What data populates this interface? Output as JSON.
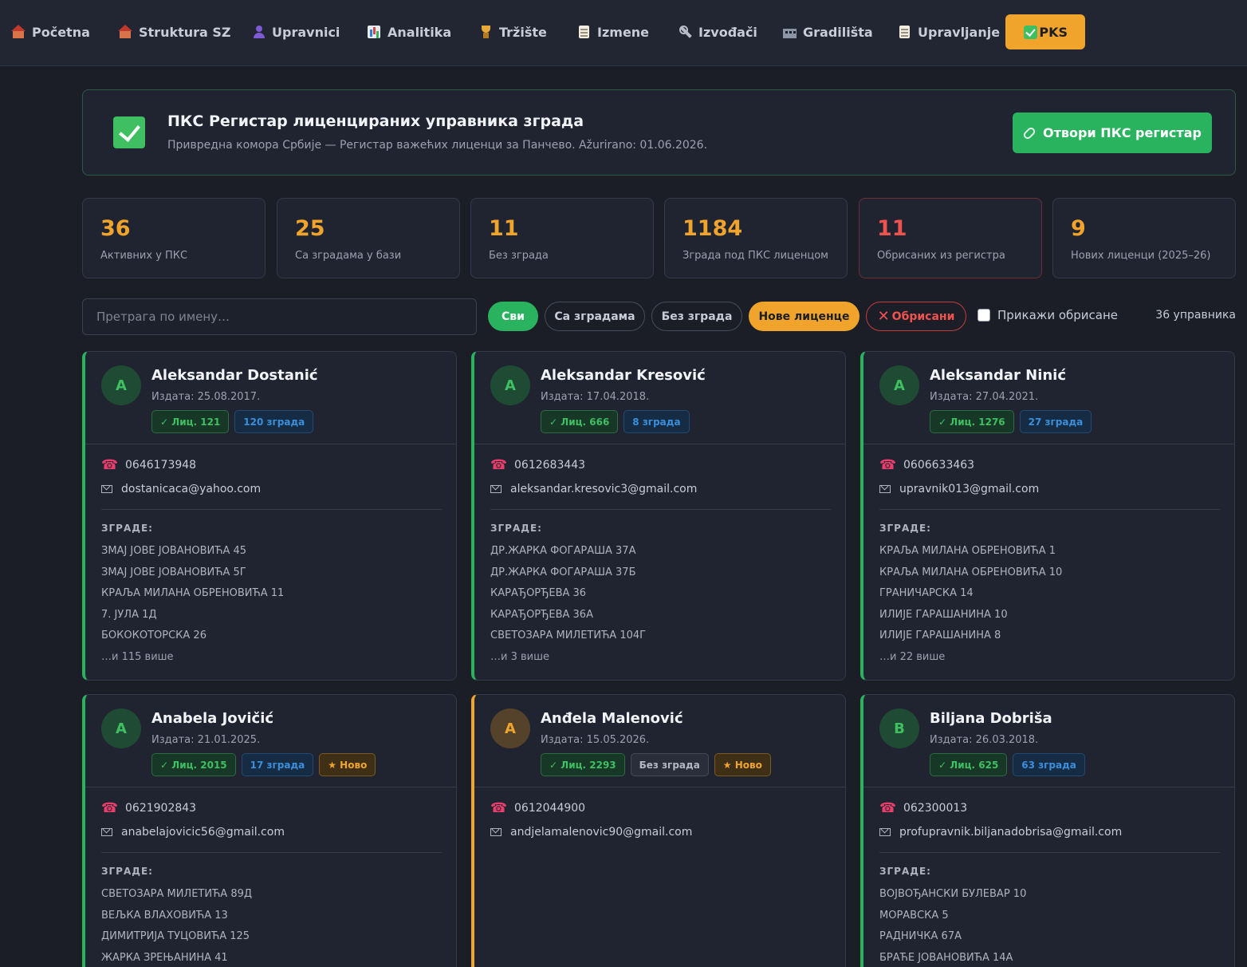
{
  "nav": [
    {
      "label": "Početna",
      "icon": "house-icon"
    },
    {
      "label": "Struktura SZ",
      "icon": "house-icon"
    },
    {
      "label": "Upravnici",
      "icon": "user-icon"
    },
    {
      "label": "Analitika",
      "icon": "chart-icon"
    },
    {
      "label": "Tržište",
      "icon": "trophy-icon"
    },
    {
      "label": "Izmene",
      "icon": "document-icon"
    },
    {
      "label": "Izvođači",
      "icon": "wrench-icon"
    },
    {
      "label": "Gradilišta",
      "icon": "construction-site-icon"
    },
    {
      "label": "Upravljanje",
      "icon": "document-icon"
    },
    {
      "label": "PKS",
      "icon": "checkmark-icon"
    }
  ],
  "header": {
    "title": "ПКС Регистар лиценцираних управника зграда",
    "subtitle": "Привредна комора Србије — Регистар важећих лиценци за Панчево. Ažurirano: 01.06.2026.",
    "open_button": "Отвори ПКС регистар"
  },
  "stats": [
    {
      "value": "36",
      "label": "Активних у ПКС"
    },
    {
      "value": "25",
      "label": "Са зградама у бази"
    },
    {
      "value": "11",
      "label": "Без зграда"
    },
    {
      "value": "1184",
      "label": "Зграда под ПКС лиценцом"
    },
    {
      "value": "11",
      "label": "Обрисаних из регистра"
    },
    {
      "value": "9",
      "label": "Нових лиценци (2025–26)"
    }
  ],
  "filters": {
    "search_placeholder": "Претрага по имену…",
    "chips": [
      "Сви",
      "Са зградама",
      "Без зграда",
      "Нове лиценце",
      "Обрисани"
    ],
    "show_deleted": "Прикажи обрисане",
    "count": "36 управника"
  },
  "buildings_title": "ЗГРАДЕ:",
  "managers": [
    {
      "initial": "A",
      "name": "Aleksandar Dostanić",
      "issued": "Издата: 25.08.2017.",
      "license": "✓ Лиц. 121",
      "buildings_badge": "120 зграда",
      "new_badge": "",
      "phone": "0646173948",
      "email": "dostanicaca@yahoo.com",
      "buildings": [
        "ЗМАЈ ЈОВЕ ЈОВАНОВИЋА 45",
        "ЗМАЈ ЈОВЕ ЈОВАНОВИЋА 5Г",
        "КРАЉА МИЛАНА ОБРЕНОВИЋА 11",
        "7. ЈУЛА 1Д",
        "БОКОКОТОРСКА 26"
      ],
      "more": "…и 115 више"
    },
    {
      "initial": "A",
      "name": "Aleksandar Kresović",
      "issued": "Издата: 17.04.2018.",
      "license": "✓ Лиц. 666",
      "buildings_badge": "8 зграда",
      "new_badge": "",
      "phone": "0612683443",
      "email": "aleksandar.kresovic3@gmail.com",
      "buildings": [
        "ДР.ЖАРКА ФОГАРАША 37А",
        "ДР.ЖАРКА ФОГАРАША 37Б",
        "КАРАЂОРЂЕВА 36",
        "КАРАЂОРЂЕВА 36А",
        "СВЕТОЗАРА МИЛЕТИЋА 104Г"
      ],
      "more": "…и 3 више"
    },
    {
      "initial": "A",
      "name": "Aleksandar Ninić",
      "issued": "Издата: 27.04.2021.",
      "license": "✓ Лиц. 1276",
      "buildings_badge": "27 зграда",
      "new_badge": "",
      "phone": "0606633463",
      "email": "upravnik013@gmail.com",
      "buildings": [
        "КРАЉА МИЛАНА ОБРЕНОВИЋА 1",
        "КРАЉА МИЛАНА ОБРЕНОВИЋА 10",
        "ГРАНИЧАРСКА 14",
        "ИЛИЈЕ ГАРАШАНИНА 10",
        "ИЛИЈЕ ГАРАШАНИНА 8"
      ],
      "more": "…и 22 више"
    },
    {
      "initial": "A",
      "name": "Anabela Jovičić",
      "issued": "Издата: 21.01.2025.",
      "license": "✓ Лиц. 2015",
      "buildings_badge": "17 зграда",
      "new_badge": "★ Ново",
      "phone": "0621902843",
      "email": "anabelajovicic56@gmail.com",
      "buildings": [
        "СВЕТОЗАРА МИЛЕТИЋА 89Д",
        "ВЕЉКА ВЛАХОВИЋА 13",
        "ДИМИТРИЈА ТУЦОВИЋА 125",
        "ЖАРКА ЗРЕЊАНИНА 41"
      ],
      "more": ""
    },
    {
      "initial": "A",
      "name": "Anđela Malenović",
      "issued": "Издата: 15.05.2026.",
      "license": "✓ Лиц. 2293",
      "buildings_badge": "Без зграда",
      "new_badge": "★ Ново",
      "phone": "0612044900",
      "email": "andjelamalenovic90@gmail.com",
      "buildings": [],
      "more": ""
    },
    {
      "initial": "B",
      "name": "Biljana Dobriša",
      "issued": "Издата: 26.03.2018.",
      "license": "✓ Лиц. 625",
      "buildings_badge": "63 зграда",
      "new_badge": "",
      "phone": "062300013",
      "email": "profupravnik.biljanadobrisa@gmail.com",
      "buildings": [
        "ВОЈВОЂАНСКИ БУЛЕВАР 10",
        "МОРАВСКА 5",
        "РАДНИЧКА 67А",
        "БРАЋЕ ЈОВАНОВИЋА 14А"
      ],
      "more": ""
    }
  ],
  "colors": {
    "accent": "#f0a42b",
    "green": "#2ab35f",
    "red": "#ef5350",
    "background": "#1b1e27"
  }
}
